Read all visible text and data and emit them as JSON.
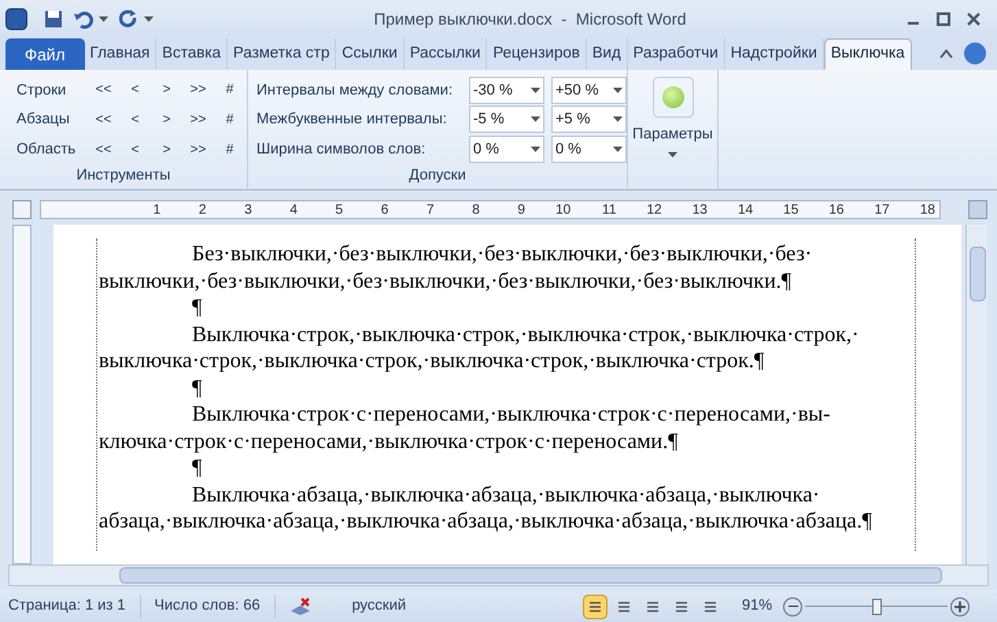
{
  "window": {
    "title": "Пример выключки.docx  -  Microsoft Word"
  },
  "tabs": [
    {
      "label": "Файл",
      "kind": "file",
      "selected": false
    },
    {
      "label": "Главная",
      "kind": "tab",
      "selected": false
    },
    {
      "label": "Вставка",
      "kind": "tab",
      "selected": false
    },
    {
      "label": "Разметка стр",
      "kind": "tab",
      "selected": false
    },
    {
      "label": "Ссылки",
      "kind": "tab",
      "selected": false
    },
    {
      "label": "Рассылки",
      "kind": "tab",
      "selected": false
    },
    {
      "label": "Рецензиров",
      "kind": "tab",
      "selected": false
    },
    {
      "label": "Вид",
      "kind": "tab",
      "selected": false
    },
    {
      "label": "Разработчи",
      "kind": "tab",
      "selected": false
    },
    {
      "label": "Надстройки",
      "kind": "tab",
      "selected": false
    },
    {
      "label": "Выключка",
      "kind": "tab",
      "selected": true
    }
  ],
  "tools": {
    "label": "Инструменты",
    "rows": [
      {
        "label": "Строки",
        "buttons": [
          "<<",
          "<",
          ">",
          ">>",
          "#"
        ]
      },
      {
        "label": "Абзацы",
        "buttons": [
          "<<",
          "<",
          ">",
          ">>",
          "#"
        ]
      },
      {
        "label": "Область",
        "buttons": [
          "<<",
          "<",
          ">",
          ">>",
          "#"
        ]
      }
    ]
  },
  "tolerances": {
    "label": "Допуски",
    "rows": [
      {
        "label": "Интервалы между словами:",
        "min": "-30 %",
        "max": "+50 %"
      },
      {
        "label": "Межбуквенные интервалы:",
        "min": "-5 %",
        "max": "+5 %"
      },
      {
        "label": "Ширина символов слов:",
        "min": "0 %",
        "max": "0 %"
      }
    ]
  },
  "params": {
    "label": "Параметры"
  },
  "ruler": {
    "numbers": [
      "1",
      "2",
      "3",
      "4",
      "5",
      "6",
      "7",
      "8",
      "9",
      "10",
      "11",
      "12",
      "13",
      "14",
      "15",
      "16",
      "17",
      "18"
    ]
  },
  "document": {
    "paragraphs": [
      {
        "lines": [
          "Без·выключки,·без·выключки,·без·выключки,·без·выключки,·без·",
          "выключки,·без·выключки,·без·выключки,·без·выключки,·без·выключки.¶"
        ]
      },
      {
        "lines": [
          "¶"
        ]
      },
      {
        "lines": [
          "Выключка·строк,·выключка·строк,·выключка·строк,·выключка·строк,·",
          "выключка·строк,·выключка·строк,·выключка·строк,·выключка·строк.¶"
        ]
      },
      {
        "lines": [
          "¶"
        ]
      },
      {
        "lines": [
          "Выключка·строк·с·переносами,·выключка·строк·с·переносами,·вы-",
          "ключка·строк·с·переносами,·выключка·строк·с·переносами.¶"
        ]
      },
      {
        "lines": [
          "¶"
        ]
      },
      {
        "lines": [
          "Выключка·абзаца,·выключка·абзаца,·выключка·абзаца,·выключка·",
          "абзаца,·выключка·абзаца,·выключка·абзаца,·выключка·абзаца,·выключка·абзаца.¶"
        ]
      }
    ]
  },
  "status_bar": {
    "page": "Страница: 1 из 1",
    "words": "Число слов: 66",
    "language": "русский",
    "views": [
      {
        "selected": true
      },
      {
        "selected": false
      },
      {
        "selected": false
      },
      {
        "selected": false
      },
      {
        "selected": false
      }
    ],
    "zoom": "91%",
    "zoom_level": {
      "level": 0.5
    }
  }
}
